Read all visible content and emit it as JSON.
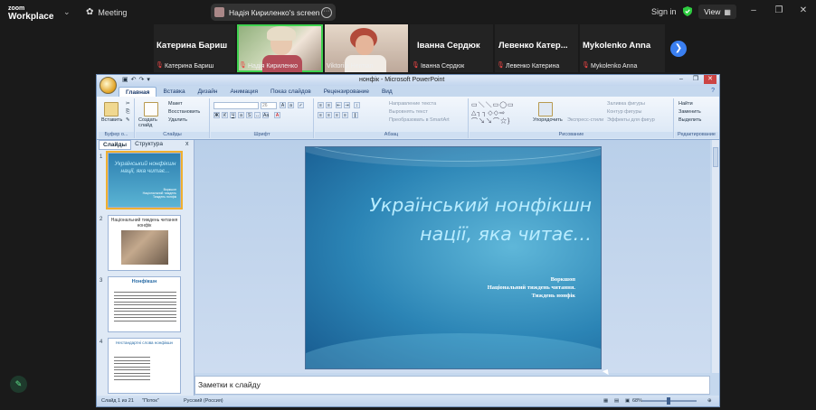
{
  "zoom": {
    "logo_line1": "zoom",
    "logo_line2": "Workplace",
    "meeting_label": "Meeting",
    "share_label": "Надія Кириленко's screen",
    "sign_in": "Sign in",
    "view": "View",
    "shield_color": "#2ecc40",
    "active_border_color": "#3fd24f"
  },
  "participants": [
    {
      "name": "Катерина Бариш",
      "caption": "Катерина Бариш",
      "muted": true,
      "video": false
    },
    {
      "name": "",
      "caption": "Надія Кириленко",
      "muted": true,
      "video": true
    },
    {
      "name": "",
      "caption": "Viktoriia Herman",
      "muted": false,
      "video": true
    },
    {
      "name": "Іванна Сердюк",
      "caption": "Іванна Сердюк",
      "muted": true,
      "video": false
    },
    {
      "name": "Левенко Катер...",
      "caption": "Левенко Катерина",
      "muted": true,
      "video": false
    },
    {
      "name": "Mykolenko Anna",
      "caption": "Mykolenko Anna",
      "muted": true,
      "video": false
    }
  ],
  "ppt": {
    "title": "нонфік - Microsoft PowerPoint",
    "tabs": [
      "Главная",
      "Вставка",
      "Дизайн",
      "Анимация",
      "Показ слайдов",
      "Рецензирование",
      "Вид"
    ],
    "groups": {
      "clipboard": "Буфер о...",
      "slides": "Слайды",
      "font": "Шрифт",
      "paragraph": "Абзац",
      "drawing": "Рисование",
      "editing": "Редактирование"
    },
    "ribbon": {
      "paste": "Вставить",
      "new_slide": "Создать слайд",
      "layout": "Макет",
      "reset": "Восстановить",
      "delete": "Удалить",
      "font_size": "26",
      "text_direction": "Направление текста",
      "align_text": "Выровнять текст",
      "smartart": "Преобразовать в SmartArt",
      "arrange": "Упорядочить",
      "quick_styles": "Экспресс-стили",
      "shape_fill": "Заливка фигуры",
      "shape_outline": "Контур фигуры",
      "shape_effects": "Эффекты для фигур",
      "find": "Найти",
      "replace": "Заменить",
      "select": "Выделить"
    },
    "pane_tabs": [
      "Слайды",
      "Структура"
    ],
    "thumbnails": [
      {
        "num": "1",
        "title": "Український нонфікшн нації, яка читає..."
      },
      {
        "num": "2",
        "title": "Національний тиждень читання нонфік"
      },
      {
        "num": "3",
        "title": "Нонфікшн"
      },
      {
        "num": "4",
        "title": "Нестандартні слова нонфікшн"
      }
    ],
    "slide": {
      "title_line1": "Український нонфікшн",
      "title_line2": "нації, яка читає…",
      "sub1": "Воркшоп",
      "sub2": "Національний тиждень читання.",
      "sub3": "Тиждень нонфік"
    },
    "notes_placeholder": "Заметки к слайду",
    "status": {
      "slide_of": "Слайд 1 из 21",
      "theme": "\"Поток\"",
      "language": "Русский (Россия)",
      "zoom": "68%"
    }
  }
}
